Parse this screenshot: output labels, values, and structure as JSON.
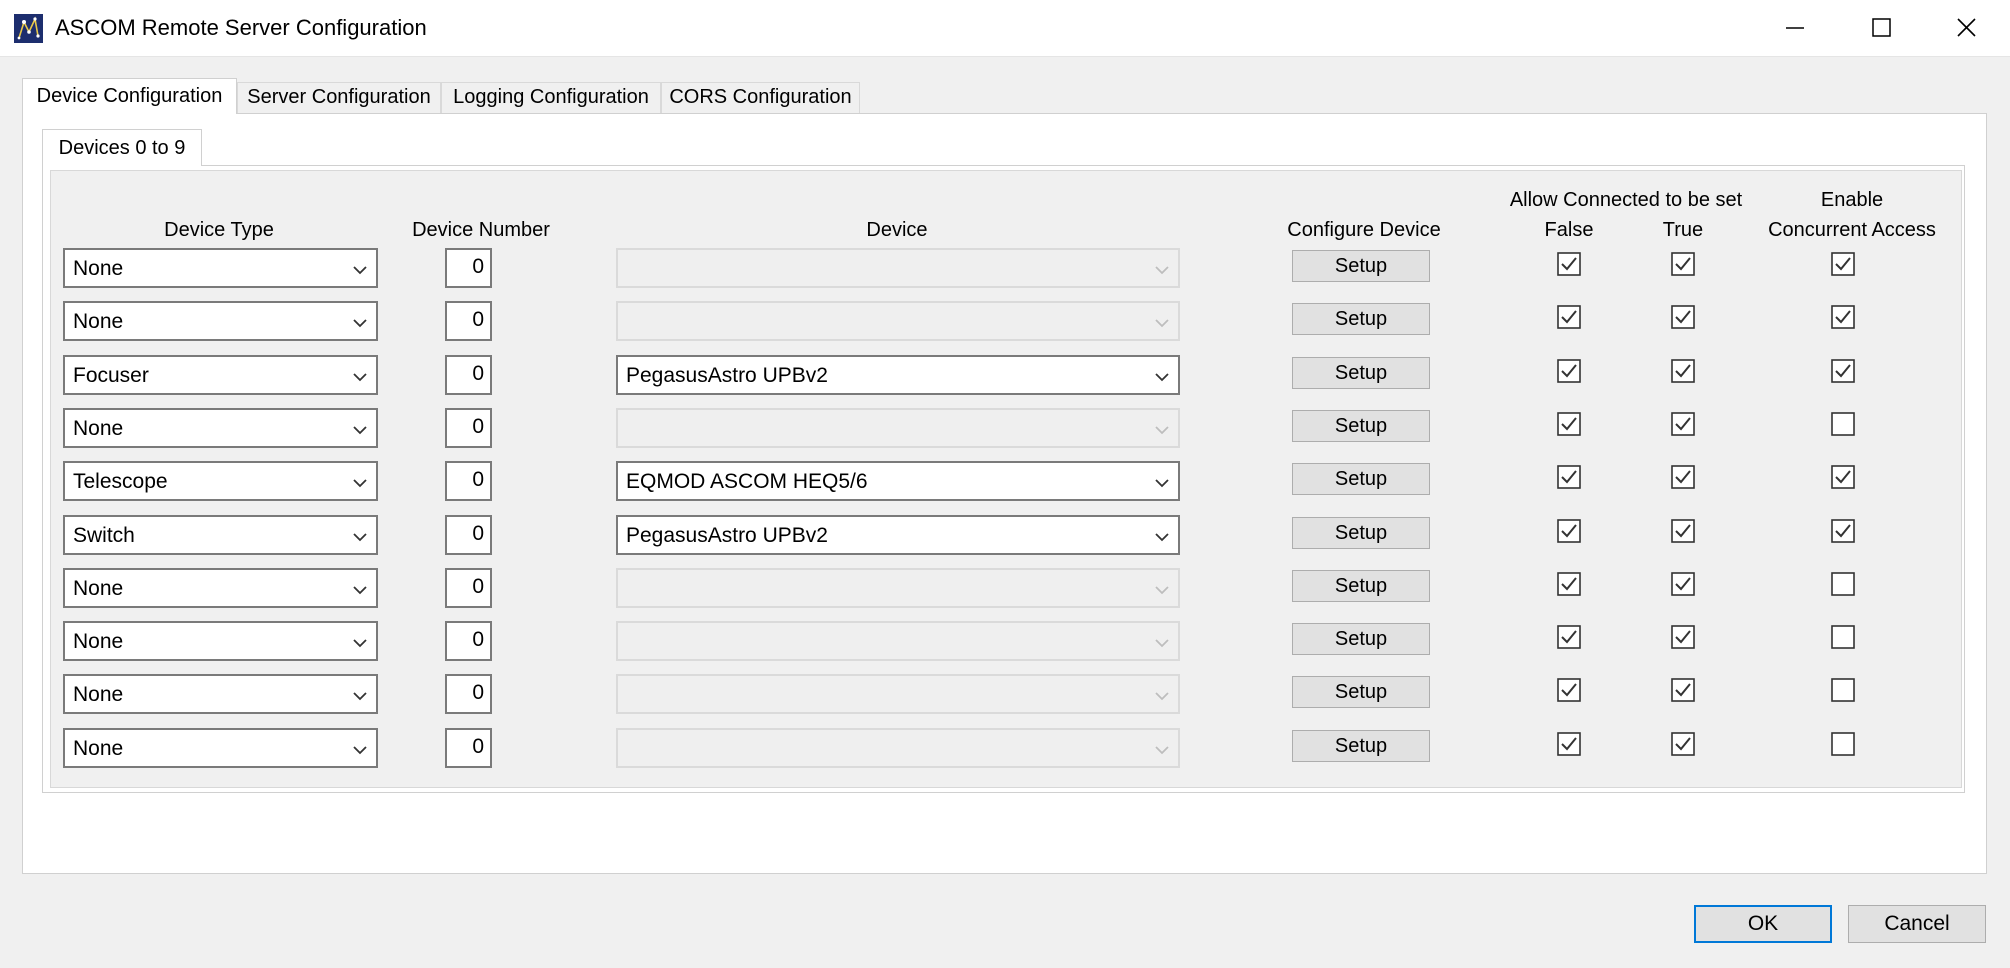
{
  "window": {
    "title": "ASCOM Remote Server Configuration",
    "app_icon": "ascom-star-icon",
    "controls": [
      "minimize-icon",
      "maximize-icon",
      "close-icon"
    ]
  },
  "tabs": [
    {
      "label": "Device Configuration",
      "active": true
    },
    {
      "label": "Server Configuration",
      "active": false
    },
    {
      "label": "Logging Configuration",
      "active": false
    },
    {
      "label": "CORS Configuration",
      "active": false
    }
  ],
  "subtab": {
    "label": "Devices 0 to 9"
  },
  "headers": {
    "device_type": "Device Type",
    "device_number": "Device Number",
    "device": "Device",
    "configure_device": "Configure Device",
    "allow_connected": "Allow Connected to be set",
    "false_label": "False",
    "true_label": "True",
    "enable": "Enable",
    "concurrent_access": "Concurrent Access"
  },
  "setup_label": "Setup",
  "devices": [
    {
      "type": "None",
      "number": "0",
      "device": "",
      "device_enabled": false,
      "allow_false": true,
      "allow_true": true,
      "concurrent": true
    },
    {
      "type": "None",
      "number": "0",
      "device": "",
      "device_enabled": false,
      "allow_false": true,
      "allow_true": true,
      "concurrent": true
    },
    {
      "type": "Focuser",
      "number": "0",
      "device": "PegasusAstro UPBv2",
      "device_enabled": true,
      "allow_false": true,
      "allow_true": true,
      "concurrent": true
    },
    {
      "type": "None",
      "number": "0",
      "device": "",
      "device_enabled": false,
      "allow_false": true,
      "allow_true": true,
      "concurrent": false
    },
    {
      "type": "Telescope",
      "number": "0",
      "device": "EQMOD ASCOM HEQ5/6",
      "device_enabled": true,
      "allow_false": true,
      "allow_true": true,
      "concurrent": true
    },
    {
      "type": "Switch",
      "number": "0",
      "device": "PegasusAstro UPBv2",
      "device_enabled": true,
      "allow_false": true,
      "allow_true": true,
      "concurrent": true
    },
    {
      "type": "None",
      "number": "0",
      "device": "",
      "device_enabled": false,
      "allow_false": true,
      "allow_true": true,
      "concurrent": false
    },
    {
      "type": "None",
      "number": "0",
      "device": "",
      "device_enabled": false,
      "allow_false": true,
      "allow_true": true,
      "concurrent": false
    },
    {
      "type": "None",
      "number": "0",
      "device": "",
      "device_enabled": false,
      "allow_false": true,
      "allow_true": true,
      "concurrent": false
    },
    {
      "type": "None",
      "number": "0",
      "device": "",
      "device_enabled": false,
      "allow_false": true,
      "allow_true": true,
      "concurrent": false
    }
  ],
  "buttons": {
    "ok": "OK",
    "cancel": "Cancel"
  },
  "colors": {
    "accent": "#0078d7",
    "icon_bg": "#1d2e6e"
  }
}
